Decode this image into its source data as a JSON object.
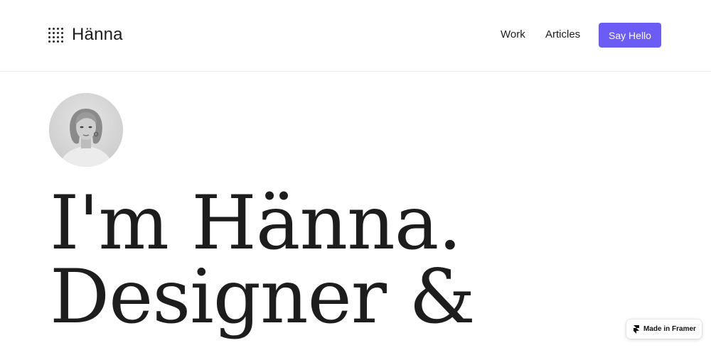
{
  "header": {
    "logo_text": "Hänna",
    "nav": [
      {
        "label": "Work"
      },
      {
        "label": "Articles"
      }
    ],
    "cta_label": "Say Hello"
  },
  "hero": {
    "avatar_icon": "portrait-photo",
    "lines": [
      "I'm Hänna.",
      "Designer &"
    ]
  },
  "badge": {
    "label": "Made in Framer",
    "icon": "framer-icon"
  },
  "colors": {
    "accent": "#6b5cf6",
    "text": "#1d1d1d",
    "background": "#ffffff"
  }
}
